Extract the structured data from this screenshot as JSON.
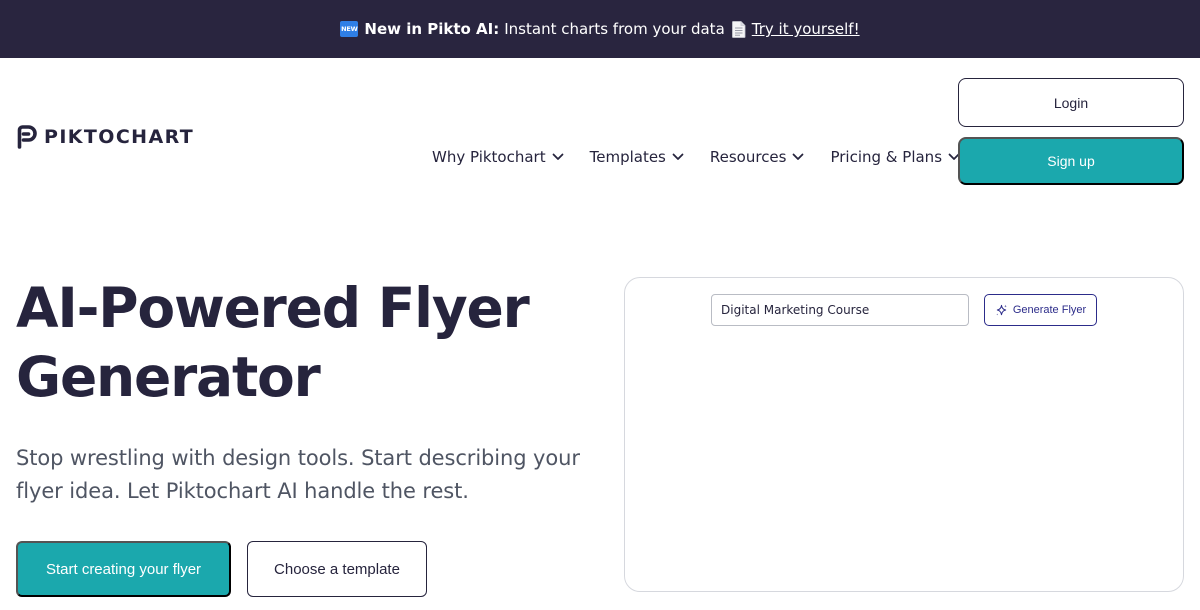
{
  "banner": {
    "badge": "NEW",
    "strong": "New in Pikto AI:",
    "text": "Instant charts from your data",
    "cta": "Try it yourself!",
    "background": "#29253f"
  },
  "header": {
    "logo_text": "PIKTOCHART",
    "nav": [
      {
        "label": "Why Piktochart"
      },
      {
        "label": "Templates"
      },
      {
        "label": "Resources"
      },
      {
        "label": "Pricing & Plans"
      }
    ],
    "login_label": "Login",
    "signup_label": "Sign up"
  },
  "hero": {
    "title_line1": "AI-Powered Flyer",
    "title_line2": "Generator",
    "subtitle_line1": "Stop wrestling with design tools. Start describing your",
    "subtitle_line2": "flyer idea. Let Piktochart AI handle the rest.",
    "primary_cta": "Start creating your flyer",
    "secondary_cta": "Choose a template"
  },
  "demo": {
    "input_value": "Digital Marketing Course",
    "generate_label": "Generate Flyer"
  },
  "colors": {
    "accent": "#1ba8ad",
    "dark": "#26243d",
    "demo_button": "#2c2c8a"
  }
}
